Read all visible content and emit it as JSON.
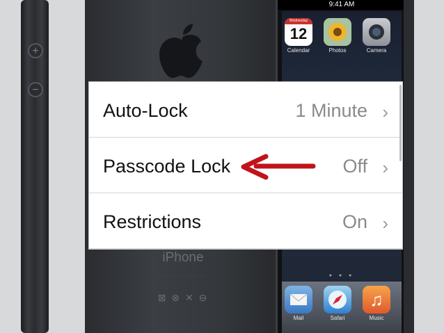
{
  "phone_front": {
    "status_time": "9:41 AM",
    "apps": [
      {
        "label": "Calendar",
        "day_name": "Wednesday",
        "day_number": "12"
      },
      {
        "label": "Photos"
      },
      {
        "label": "Camera"
      }
    ],
    "dock": [
      {
        "label": "Mail"
      },
      {
        "label": "Safari"
      },
      {
        "label": "Music"
      }
    ]
  },
  "phone_back": {
    "brand": "iPhone"
  },
  "settings": {
    "rows": [
      {
        "label": "Auto-Lock",
        "value": "1 Minute"
      },
      {
        "label": "Passcode Lock",
        "value": "Off"
      },
      {
        "label": "Restrictions",
        "value": "On"
      }
    ]
  },
  "annotation": {
    "arrow_color": "#c0141a"
  }
}
